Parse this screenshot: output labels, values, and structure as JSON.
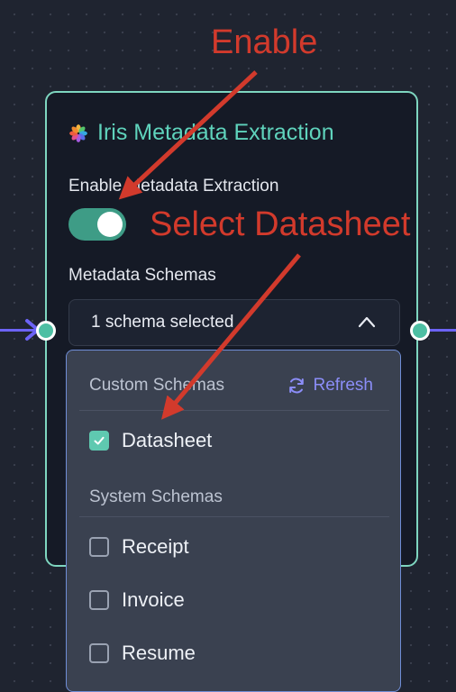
{
  "node": {
    "title": "Iris Metadata Extraction",
    "enable_label": "Enable Metadata Extraction",
    "toggle_on": true,
    "schemas_label": "Metadata Schemas",
    "select_value": "1 schema selected"
  },
  "dropdown": {
    "custom_header": "Custom Schemas",
    "refresh_label": "Refresh",
    "custom_items": [
      {
        "label": "Datasheet",
        "checked": true
      }
    ],
    "system_header": "System Schemas",
    "system_items": [
      {
        "label": "Receipt",
        "checked": false
      },
      {
        "label": "Invoice",
        "checked": false
      },
      {
        "label": "Resume",
        "checked": false
      }
    ]
  },
  "annotations": {
    "enable": "Enable",
    "select_datasheet": "Select Datasheet"
  },
  "colors": {
    "accent_teal": "#5fd3bc",
    "annotation_red": "#d23a2c",
    "edge_purple": "#6c63f5",
    "refresh_purple": "#8b8df7"
  },
  "icons": [
    "iris-logo-icon",
    "chevron-up-icon",
    "refresh-icon",
    "checkmark-icon",
    "edge-arrow-icon"
  ]
}
